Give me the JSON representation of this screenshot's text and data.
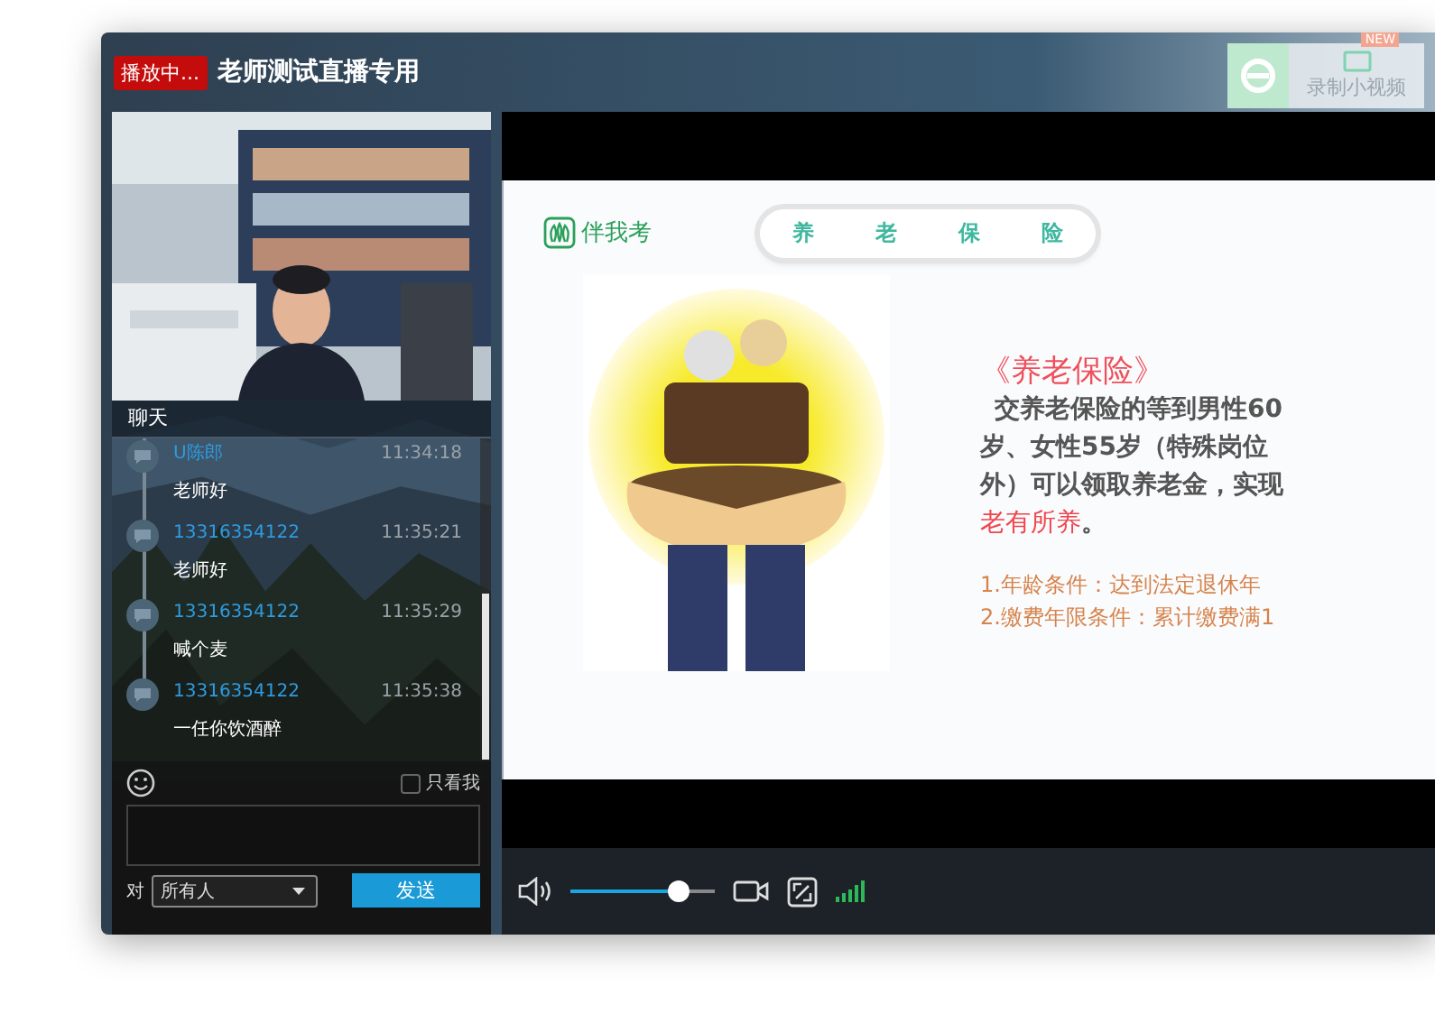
{
  "window": {
    "status_badge": "播放中...",
    "title": "老师测试直播专用"
  },
  "record_button": {
    "label": "录制小视频",
    "badge": "NEW"
  },
  "chat": {
    "title": "聊天",
    "messages": [
      {
        "user": "U陈郎",
        "time": "11:34:18",
        "text": "老师好"
      },
      {
        "user": "13316354122",
        "time": "11:35:21",
        "text": "老师好"
      },
      {
        "user": "13316354122",
        "time": "11:35:29",
        "text": "喊个麦"
      },
      {
        "user": "13316354122",
        "time": "11:35:38",
        "text": "一任你饮酒醉"
      }
    ],
    "only_me": {
      "label": "只看我",
      "checked": false
    },
    "recipient_label": "对",
    "recipient": "所有人",
    "send_button": "发送"
  },
  "slide": {
    "logo": "伴我考",
    "banner": [
      "养",
      "老",
      "保",
      "险"
    ],
    "heading": "《养老保险》",
    "body": [
      "交养老保险的等到男性60",
      "岁、女性55岁（特殊岗位",
      "外）可以领取养老金，实现"
    ],
    "highlight": "老有所养",
    "highlight_tail": "。",
    "conditions": [
      "1.年龄条件：达到法定退休年",
      "2.缴费年限条件：累计缴费满1"
    ]
  },
  "player": {
    "volume": {
      "level": 0.75
    }
  }
}
